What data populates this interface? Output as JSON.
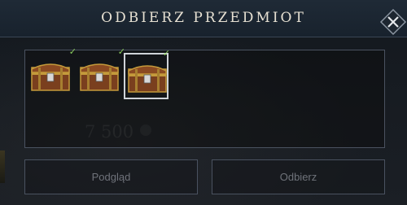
{
  "dialog": {
    "title": "ODBIERZ PRZEDMIOT",
    "close_icon": "close-x-icon"
  },
  "background": {
    "faded_amount": "7 500"
  },
  "items": [
    {
      "icon": "treasure-chest-icon",
      "claimed": true,
      "selected": false
    },
    {
      "icon": "treasure-chest-icon",
      "claimed": true,
      "selected": false
    },
    {
      "icon": "treasure-chest-icon",
      "claimed": true,
      "selected": true
    }
  ],
  "check_glyph": "✓",
  "buttons": {
    "preview_label": "Podgląd",
    "claim_label": "Odbierz"
  },
  "colors": {
    "accent_check": "#8ccd5e",
    "title_text": "#e7e1d3",
    "button_text_disabled": "#6f737a"
  }
}
